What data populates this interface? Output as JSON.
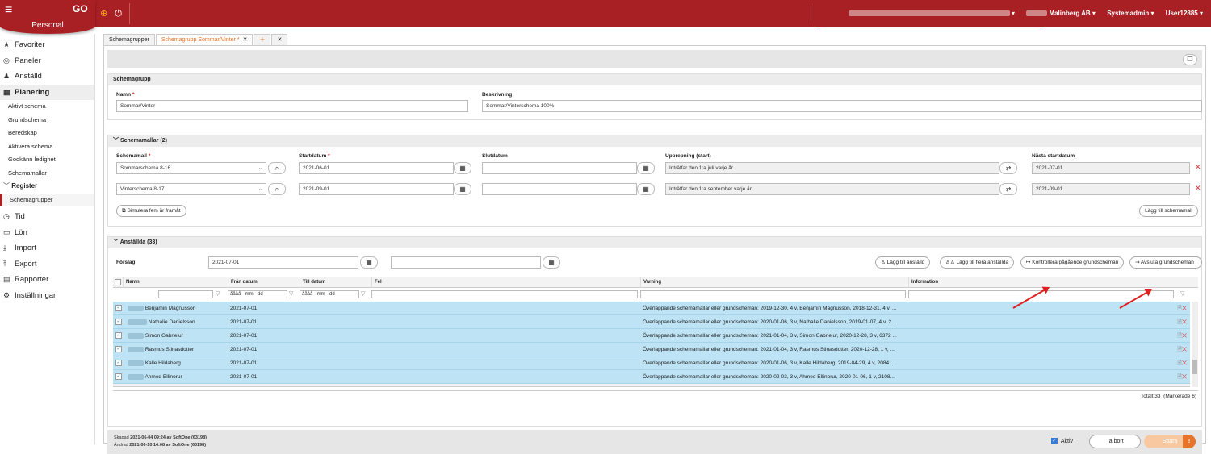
{
  "header": {
    "module": "Personal",
    "company": "Malinberg AB",
    "role": "Systemadmin",
    "user": "User12885"
  },
  "sidebar": {
    "items": [
      {
        "label": "Favoriter",
        "icon": "star-icon"
      },
      {
        "label": "Paneler",
        "icon": "dashboard-icon"
      },
      {
        "label": "Anställd",
        "icon": "users-icon"
      },
      {
        "label": "Planering",
        "icon": "calendar-icon"
      }
    ],
    "planering_sub": [
      "Aktivt schema",
      "Grundschema",
      "Beredskap",
      "Aktivera schema",
      "Godkänn ledighet",
      "Schemamallar"
    ],
    "register_label": "Register",
    "register_sub": [
      "Schemagrupper"
    ],
    "bottom_items": [
      {
        "label": "Tid",
        "icon": "clock-icon"
      },
      {
        "label": "Lön",
        "icon": "money-icon"
      },
      {
        "label": "Import",
        "icon": "import-icon"
      },
      {
        "label": "Export",
        "icon": "export-icon"
      },
      {
        "label": "Rapporter",
        "icon": "print-icon"
      },
      {
        "label": "Inställningar",
        "icon": "gear-icon"
      }
    ]
  },
  "tabs": [
    {
      "label": "Schemagrupper"
    },
    {
      "label": "Schemagrupp Sommar/Vinter *"
    }
  ],
  "schemagrupp": {
    "title": "Schemagrupp",
    "name_label": "Namn",
    "name_value": "Sommar/Vinter",
    "desc_label": "Beskrivning",
    "desc_value": "Sommar/Vinterschema 100%"
  },
  "schemamallar": {
    "title": "Schemamallar (2)",
    "col_mall": "Schemamall",
    "col_start": "Startdatum",
    "col_slut": "Slutdatum",
    "col_upprep": "Upprepning (start)",
    "col_nasta": "Nästa startdatum",
    "rows": [
      {
        "mall": "Sommarschema 8-16",
        "start": "2021-06-01",
        "slut": "",
        "upprep": "Inträffar den 1:a juli varje år",
        "nasta": "2021-07-01"
      },
      {
        "mall": "Vinterschema 8-17",
        "start": "2021-09-01",
        "slut": "",
        "upprep": "Inträffar den 1:a september varje år",
        "nasta": "2021-09-01"
      }
    ],
    "simulate_label": "Simulera fem år framåt",
    "add_label": "Lägg till schemamall"
  },
  "anstallda": {
    "title": "Anställda (33)",
    "forslag_label": "Förslag",
    "forslag_value": "2021-07-01",
    "btn_add": "Lägg till anställd",
    "btn_add_many": "Lägg till flera anställda",
    "btn_check": "Kontrollera pågående grundscheman",
    "btn_end": "Avsluta grundscheman",
    "columns": [
      "Namn",
      "Från datum",
      "Till datum",
      "Fel",
      "Varning",
      "Information"
    ],
    "date_placeholder": "åååå - mm - dd",
    "rows": [
      {
        "name": "Benjamin Magnusson",
        "from": "2021-07-01",
        "warning": "Överlappande schemamallar eller grundscheman: 2019-12-30, 4 v, Benjamin Magnusson, 2018-12-31, 4 v, ..."
      },
      {
        "name": "Nathalie Danielsson",
        "from": "2021-07-01",
        "warning": "Överlappande schemamallar eller grundscheman: 2020-01-06, 3 v, Nathalie Danielsson, 2019-01-07, 4 v, 2..."
      },
      {
        "name": "Simon Gabrielur",
        "from": "2021-07-01",
        "warning": "Överlappande schemamallar eller grundscheman: 2021-01-04, 3 v, Simon Gabrielur, 2020-12-28, 3 v, 6372 ..."
      },
      {
        "name": "Rasmus Stinasdotter",
        "from": "2021-07-01",
        "warning": "Överlappande schemamallar eller grundscheman: 2021-01-04, 3 v, Rasmus Stinasdotter, 2020-12-28, 1 v, ..."
      },
      {
        "name": "Kalle Hildaberg",
        "from": "2021-07-01",
        "warning": "Överlappande schemamallar eller grundscheman: 2020-01-06, 3 v, Kalle Hildaberg, 2019-04-29, 4 v, 2084..."
      },
      {
        "name": "Ahmed Ellinorur",
        "from": "2021-07-01",
        "warning": "Överlappande schemamallar eller grundscheman: 2020-02-03, 3 v, Ahmed Ellinorur, 2020-01-06, 1 v, 2108..."
      }
    ],
    "total_label": "Totalt 33",
    "marked_label": "(Markerade 6)"
  },
  "footer": {
    "created_label": "Skapad",
    "created": "2021-06-04 09:24",
    "created_by": "av SoftOne (63198)",
    "changed_label": "Ändrad",
    "changed": "2021-06-10 14:08",
    "changed_by": "av SoftOne (63198)",
    "aktiv_label": "Aktiv",
    "delete_label": "Ta bort",
    "save_label": "Spara",
    "save_badge": "!"
  },
  "colors": {
    "brand": "#a81f24",
    "accent": "#e6742b",
    "selected_row": "#bde3f5"
  }
}
